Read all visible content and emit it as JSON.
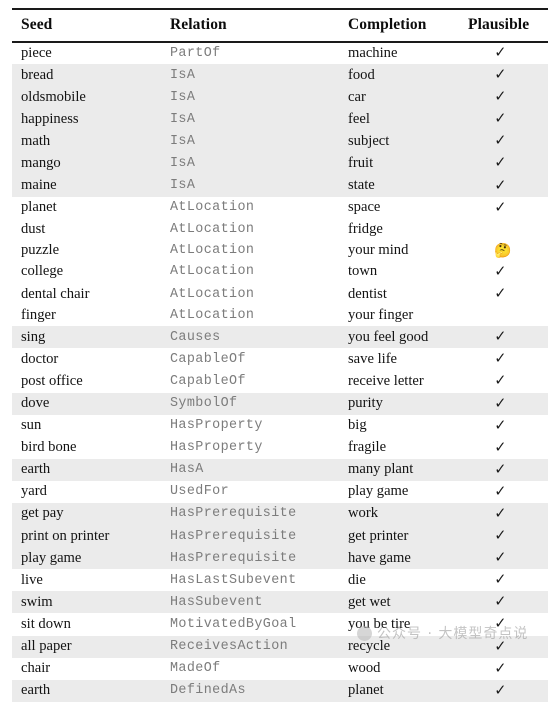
{
  "table": {
    "columns": [
      "Seed",
      "Relation",
      "Completion",
      "Plausible"
    ],
    "marks": {
      "check": "✓",
      "thinking": "🤔",
      "none": ""
    },
    "rows": [
      {
        "seed": "piece",
        "relation": "PartOf",
        "completion": "machine",
        "plausible": "✓",
        "shaded": false
      },
      {
        "seed": "bread",
        "relation": "IsA",
        "completion": "food",
        "plausible": "✓",
        "shaded": true
      },
      {
        "seed": "oldsmobile",
        "relation": "IsA",
        "completion": "car",
        "plausible": "✓",
        "shaded": true
      },
      {
        "seed": "happiness",
        "relation": "IsA",
        "completion": "feel",
        "plausible": "✓",
        "shaded": true
      },
      {
        "seed": "math",
        "relation": "IsA",
        "completion": "subject",
        "plausible": "✓",
        "shaded": true
      },
      {
        "seed": "mango",
        "relation": "IsA",
        "completion": "fruit",
        "plausible": "✓",
        "shaded": true
      },
      {
        "seed": "maine",
        "relation": "IsA",
        "completion": "state",
        "plausible": "✓",
        "shaded": true
      },
      {
        "seed": "planet",
        "relation": "AtLocation",
        "completion": "space",
        "plausible": "✓",
        "shaded": false
      },
      {
        "seed": "dust",
        "relation": "AtLocation",
        "completion": "fridge",
        "plausible": "",
        "shaded": false
      },
      {
        "seed": "puzzle",
        "relation": "AtLocation",
        "completion": "your mind",
        "plausible": "🤔",
        "shaded": false
      },
      {
        "seed": "college",
        "relation": "AtLocation",
        "completion": "town",
        "plausible": "✓",
        "shaded": false
      },
      {
        "seed": "dental chair",
        "relation": "AtLocation",
        "completion": "dentist",
        "plausible": "✓",
        "shaded": false
      },
      {
        "seed": "finger",
        "relation": "AtLocation",
        "completion": "your finger",
        "plausible": "",
        "shaded": false
      },
      {
        "seed": "sing",
        "relation": "Causes",
        "completion": "you feel good",
        "plausible": "✓",
        "shaded": true
      },
      {
        "seed": "doctor",
        "relation": "CapableOf",
        "completion": "save life",
        "plausible": "✓",
        "shaded": false
      },
      {
        "seed": "post office",
        "relation": "CapableOf",
        "completion": "receive letter",
        "plausible": "✓",
        "shaded": false
      },
      {
        "seed": "dove",
        "relation": "SymbolOf",
        "completion": "purity",
        "plausible": "✓",
        "shaded": true
      },
      {
        "seed": "sun",
        "relation": "HasProperty",
        "completion": "big",
        "plausible": "✓",
        "shaded": false
      },
      {
        "seed": "bird bone",
        "relation": "HasProperty",
        "completion": "fragile",
        "plausible": "✓",
        "shaded": false
      },
      {
        "seed": "earth",
        "relation": "HasA",
        "completion": "many plant",
        "plausible": "✓",
        "shaded": true
      },
      {
        "seed": "yard",
        "relation": "UsedFor",
        "completion": "play game",
        "plausible": "✓",
        "shaded": false
      },
      {
        "seed": "get pay",
        "relation": "HasPrerequisite",
        "completion": "work",
        "plausible": "✓",
        "shaded": true
      },
      {
        "seed": "print on printer",
        "relation": "HasPrerequisite",
        "completion": "get printer",
        "plausible": "✓",
        "shaded": true
      },
      {
        "seed": "play game",
        "relation": "HasPrerequisite",
        "completion": "have game",
        "plausible": "✓",
        "shaded": true
      },
      {
        "seed": "live",
        "relation": "HasLastSubevent",
        "completion": "die",
        "plausible": "✓",
        "shaded": false
      },
      {
        "seed": "swim",
        "relation": "HasSubevent",
        "completion": "get wet",
        "plausible": "✓",
        "shaded": true
      },
      {
        "seed": "sit down",
        "relation": "MotivatedByGoal",
        "completion": "you be tire",
        "plausible": "✓",
        "shaded": false
      },
      {
        "seed": "all paper",
        "relation": "ReceivesAction",
        "completion": "recycle",
        "plausible": "✓",
        "shaded": true
      },
      {
        "seed": "chair",
        "relation": "MadeOf",
        "completion": "wood",
        "plausible": "✓",
        "shaded": false
      },
      {
        "seed": "earth",
        "relation": "DefinedAs",
        "completion": "planet",
        "plausible": "✓",
        "shaded": true
      }
    ]
  },
  "watermark": {
    "text": "公众号 · 大模型奇点说"
  }
}
